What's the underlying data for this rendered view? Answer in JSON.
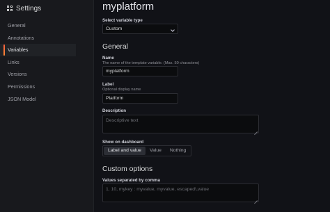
{
  "app": {
    "title": "Settings"
  },
  "sidebar": {
    "items": [
      {
        "label": "General"
      },
      {
        "label": "Annotations"
      },
      {
        "label": "Variables"
      },
      {
        "label": "Links"
      },
      {
        "label": "Versions"
      },
      {
        "label": "Permissions"
      },
      {
        "label": "JSON Model"
      }
    ],
    "active": "Variables"
  },
  "main": {
    "title": "myplatform",
    "variable_type": {
      "label": "Select variable type",
      "value": "Custom"
    },
    "general_heading": "General",
    "name": {
      "label": "Name",
      "description": "The name of the template variable. (Max. 50 characters)",
      "value": "myplatform"
    },
    "display_label": {
      "label": "Label",
      "description": "Optional display name",
      "value": "Platform"
    },
    "description": {
      "label": "Description",
      "placeholder": "Descriptive text"
    },
    "show_on_dashboard": {
      "label": "Show on dashboard",
      "options": [
        "Label and value",
        "Value",
        "Nothing"
      ],
      "selected": "Label and value"
    },
    "custom_heading": "Custom options",
    "values": {
      "label": "Values separated by comma",
      "placeholder": "1, 10, mykey : myvalue, myvalue, escaped\\,value"
    }
  },
  "colors": {
    "accent": "#f55f3e",
    "background": "#111217",
    "sidebar": "#18191d"
  }
}
